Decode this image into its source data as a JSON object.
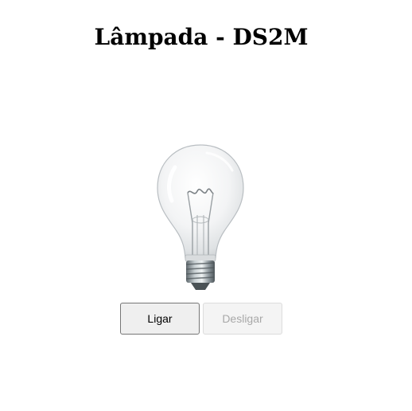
{
  "header": {
    "title": "Lâmpada - DS2M"
  },
  "lamp": {
    "state": "off",
    "icon": "light-bulb-icon"
  },
  "controls": {
    "on_label": "Ligar",
    "off_label": "Desligar",
    "off_disabled": true
  },
  "colors": {
    "on_button_border": "#767676",
    "disabled_text": "#a8a8a8"
  }
}
